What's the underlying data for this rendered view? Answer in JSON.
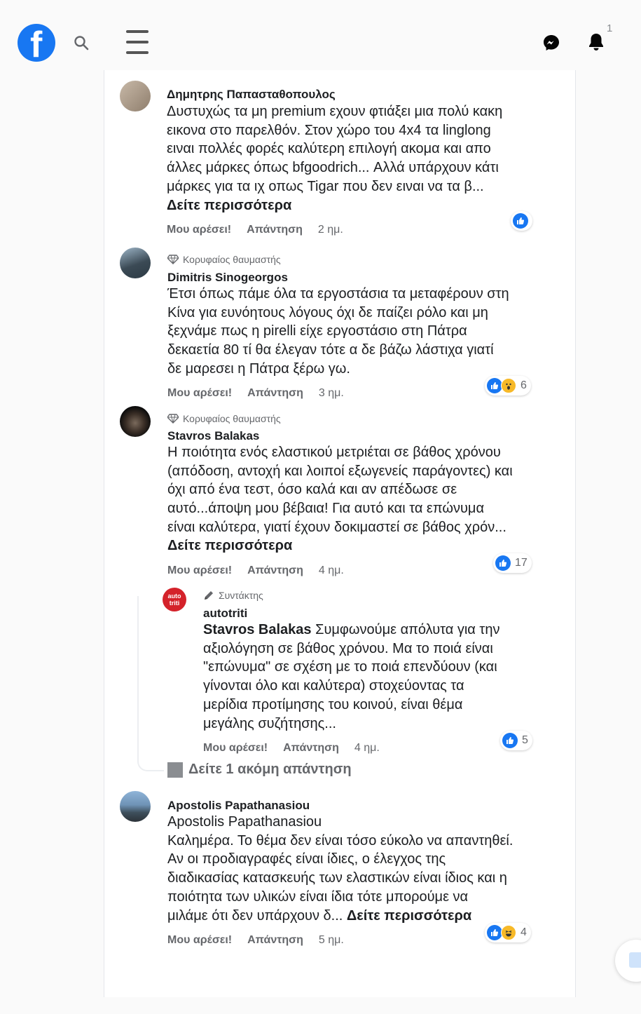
{
  "header": {
    "logo_letter": "f",
    "notification_count": "1",
    "brand_color": "#1877f2"
  },
  "comments": [
    {
      "author": "Δημητρης Παπασταθοπουλος",
      "text_lines": [
        "Δυστυχώς τα μη premium εχουν φτιάξει μια πολύ κακη",
        "εικονα στο παρελθόν. Στον χώρο του 4x4 τα linglong",
        "ειναι πολλές φορές καλύτερη επιλογή ακομα και απο",
        "άλλες μάρκες όπως bfgoodrich... Αλλά υπάρχουν κάτι",
        "μάρκες για τα ιχ οπως Tigar που δεν ειναι να τα β..."
      ],
      "see_more": "Δείτε περισσότερα",
      "like": "Μου αρέσει!",
      "reply": "Απάντηση",
      "time": "2 ημ.",
      "reaction_count": ""
    },
    {
      "badge": "Κορυφαίος θαυμαστής",
      "author": "Dimitris Sinogeorgos",
      "text_lines": [
        "Έτσι όπως πάμε όλα τα εργοστάσια τα μεταφέρουν στη",
        "Κίνα για ευνόητους λόγους όχι δε παίζει ρόλο και μη",
        "ξεχνάμε πως η pirelli είχε εργοστάσιο στη Πάτρα",
        "δεκαετία 80 τί θα έλεγαν τότε α δε βάζω λάστιχα γιατί",
        "δε μαρεσει η Πάτρα ξέρω γω."
      ],
      "like": "Μου αρέσει!",
      "reply": "Απάντηση",
      "time": "3 ημ.",
      "reaction_count": "6"
    },
    {
      "badge": "Κορυφαίος θαυμαστής",
      "author": "Stavros Balakas",
      "text_lines": [
        "Η ποιότητα ενός ελαστικού μετριέται σε βάθος χρόνου",
        "(απόδοση, αντοχή και λοιποί εξωγενείς παράγοντες) και",
        "όχι από ένα τεστ, όσο καλά και αν απέδωσε σε",
        "αυτό...άποψη μου βέβαια! Για αυτό και τα επώνυμα",
        "είναι καλύτερα, γιατί έχουν δοκιμαστεί σε βάθος χρόν..."
      ],
      "see_more": "Δείτε περισσότερα",
      "like": "Μου αρέσει!",
      "reply": "Απάντηση",
      "time": "4 ημ.",
      "reaction_count": "17"
    },
    {
      "badge": "Συντάκτης",
      "author": "autotriti",
      "avatar_text": "auto triti",
      "mention": "Stavros Balakas",
      "text_lines": [
        " Συμφωνούμε απόλυτα για την",
        "αξιολόγηση σε βάθος χρόνου. Μα το ποιά είναι",
        "\"επώνυμα\" σε σχέση με το ποιά επενδύουν (και",
        "γίνονται όλο και καλύτερα) στοχεύοντας τα",
        "μερίδια προτίμησης του κοινού, είναι θέμα",
        "μεγάλης συζήτησης..."
      ],
      "like": "Μου αρέσει!",
      "reply": "Απάντηση",
      "time": "4 ημ.",
      "reaction_count": "5"
    },
    {
      "author": "Apostolis Papathanasiou",
      "text_lines": [
        "Apostolis Papathanasiou",
        "Καλημέρα. Το θέμα δεν είναι τόσο εύκολο να απαντηθεί.",
        "Αν οι προδιαγραφές είναι ίδιες, ο έλεγχος της",
        "διαδικασίας κατασκευής των ελαστικών είναι ίδιος και η",
        "ποιότητα των υλικών είναι ίδια τότε μπορούμε να",
        "μιλάμε ότι δεν υπάρχουν δ... "
      ],
      "see_more": "Δείτε περισσότερα",
      "like": "Μου αρέσει!",
      "reply": "Απάντηση",
      "time": "5 ημ.",
      "reaction_count": "4"
    }
  ],
  "more_replies": "Δείτε 1 ακόμη απάντηση"
}
